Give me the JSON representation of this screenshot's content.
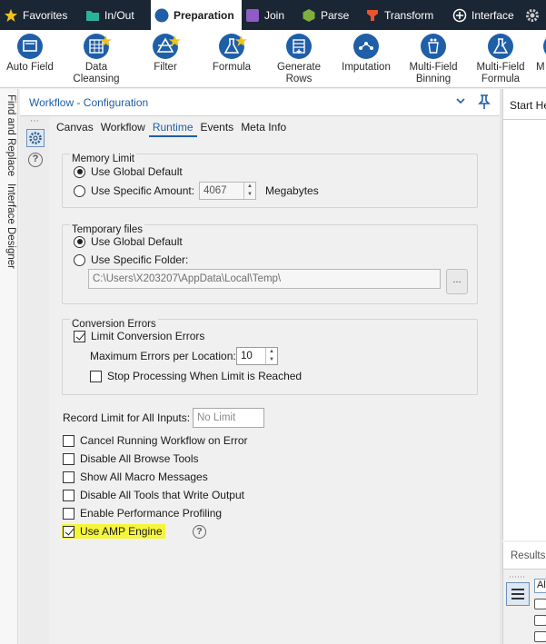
{
  "categories": [
    {
      "label": "Favorites",
      "icon": "star-icon",
      "color": "#f2c21b"
    },
    {
      "label": "In/Out",
      "icon": "folder-icon",
      "color": "#2bb39a"
    },
    {
      "label": "Preparation",
      "icon": "preparation-icon",
      "color": "#1f5fa8"
    },
    {
      "label": "Join",
      "icon": "join-icon",
      "color": "#8e5cc4"
    },
    {
      "label": "Parse",
      "icon": "parse-icon",
      "color": "#7fae3c"
    },
    {
      "label": "Transform",
      "icon": "transform-icon",
      "color": "#e8542f"
    },
    {
      "label": "Interface",
      "icon": "interface-icon",
      "color": "#ffffff"
    },
    {
      "label": "",
      "icon": "gear-icon",
      "color": "#cccccc"
    }
  ],
  "active_category": "Preparation",
  "tools": [
    {
      "label_1": "Auto Field",
      "label_2": "",
      "icon": "auto-field-icon",
      "favorite": false
    },
    {
      "label_1": "Data",
      "label_2": "Cleansing",
      "icon": "data-cleansing-icon",
      "favorite": true
    },
    {
      "label_1": "Filter",
      "label_2": "",
      "icon": "filter-icon",
      "favorite": true
    },
    {
      "label_1": "Formula",
      "label_2": "",
      "icon": "formula-icon",
      "favorite": true
    },
    {
      "label_1": "Generate",
      "label_2": "Rows",
      "icon": "generate-rows-icon",
      "favorite": false
    },
    {
      "label_1": "Imputation",
      "label_2": "",
      "icon": "imputation-icon",
      "favorite": false
    },
    {
      "label_1": "Multi-Field",
      "label_2": "Binning",
      "icon": "multi-field-binning-icon",
      "favorite": false
    },
    {
      "label_1": "Multi-Field",
      "label_2": "Formula",
      "icon": "multi-field-formula-icon",
      "favorite": false
    },
    {
      "label_1": "M",
      "label_2": "",
      "icon": "next-tool-icon",
      "favorite": false
    }
  ],
  "left_panels": [
    "Find and Replace",
    "Interface Designer"
  ],
  "config": {
    "title": "Workflow - Configuration",
    "tabs": [
      "Canvas",
      "Workflow",
      "Runtime",
      "Events",
      "Meta Info"
    ],
    "active_tab": "Runtime",
    "memory": {
      "title": "Memory Limit",
      "opt_global": "Use Global Default",
      "opt_specific": "Use Specific Amount:",
      "amount": "4067",
      "unit": "Megabytes"
    },
    "temp": {
      "title": "Temporary files",
      "opt_global": "Use Global Default",
      "opt_specific": "Use Specific Folder:",
      "folder": "C:\\Users\\X203207\\AppData\\Local\\Temp\\",
      "browse": "..."
    },
    "errors": {
      "title": "Conversion Errors",
      "limit": "Limit Conversion Errors",
      "max_label": "Maximum Errors per Location:",
      "max_value": "10",
      "stop": "Stop Processing When Limit is Reached"
    },
    "record_limit": {
      "label": "Record Limit for All Inputs:",
      "placeholder": "No Limit"
    },
    "options": [
      {
        "label": "Cancel Running Workflow on Error",
        "checked": false
      },
      {
        "label": "Disable All Browse Tools",
        "checked": false
      },
      {
        "label": "Show All Macro Messages",
        "checked": false
      },
      {
        "label": "Disable All Tools that Write Output",
        "checked": false
      },
      {
        "label": "Enable Performance Profiling",
        "checked": false
      },
      {
        "label": "Use AMP Engine",
        "checked": true,
        "highlighted": true
      }
    ],
    "help_glyph": "?"
  },
  "right_panel": {
    "title": "Start He"
  },
  "results": {
    "title": "Results",
    "tab_label": "Al"
  }
}
